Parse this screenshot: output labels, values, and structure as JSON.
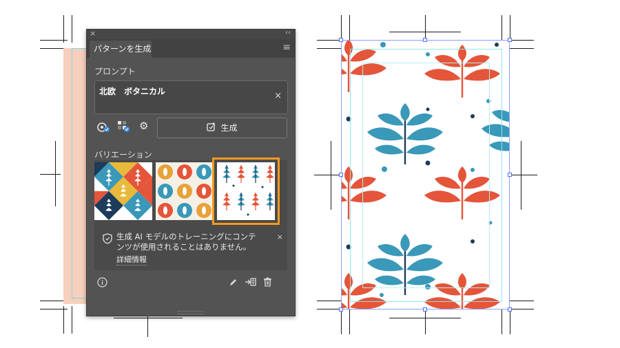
{
  "panel": {
    "close_glyph": "×",
    "collapse_glyph": "‹‹",
    "tab_title": "パターンを生成",
    "menu_icon": "hamburger-menu-icon",
    "prompt_label": "プロンプト",
    "prompt_value": "北欧　ボタニカル",
    "clear_glyph": "×",
    "generate_label": "生成",
    "variations_label": "バリエーション",
    "info_text": "生成 AI モデルのトレーニングにコンテンツが使用されることはありません。",
    "info_link": "詳細情報",
    "info_close": "×"
  },
  "colors": {
    "panel_bg": "#535353",
    "selection": "#f39a1d",
    "pattern_red": "#e4553a",
    "pattern_teal": "#3a98b8",
    "pattern_navy": "#1d3b5a",
    "pattern_yellow": "#e8b93a"
  },
  "icons": [
    "style-reference-icon",
    "match-color-icon",
    "settings-icon",
    "generate-icon",
    "shield-icon",
    "info-icon",
    "edit-icon",
    "apply-icon",
    "trash-icon"
  ]
}
